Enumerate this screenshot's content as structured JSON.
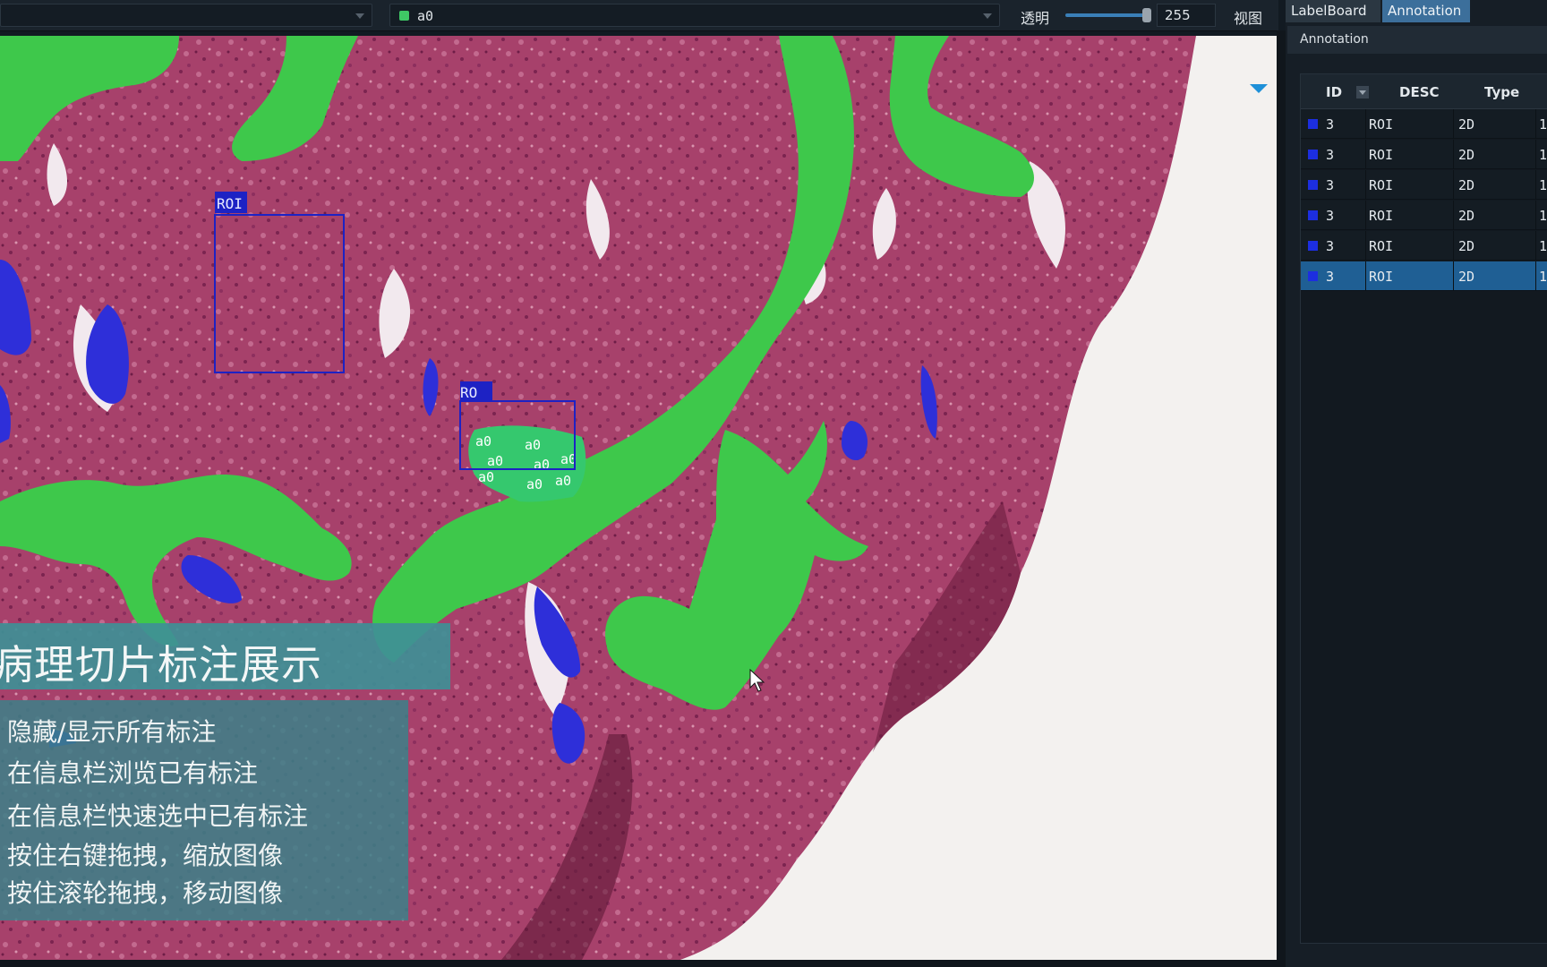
{
  "toolbar": {
    "label_select_value": "a0",
    "label_color": "#3fc865",
    "opacity_label": "透明",
    "opacity_value": "255",
    "opacity_level": 1.0,
    "view_label": "视图"
  },
  "viewer": {
    "roi_tag": "ROI",
    "roi_tag_partial": "RO",
    "annotation_text": "a0",
    "colors": {
      "tissue": "#a7416b",
      "background": "#f3f1ef",
      "green_annotation": "#3ec84b",
      "blue_annotation": "#2e2fd9",
      "roi_box": "#1d22c4"
    }
  },
  "overlay": {
    "title": "病理切片标注展示",
    "steps": [
      "隐藏/显示所有标注",
      "在信息栏浏览已有标注",
      "在信息栏快速选中已有标注",
      "按住右键拖拽，缩放图像",
      "按住滚轮拖拽，移动图像"
    ]
  },
  "right_panel": {
    "tabs": [
      "LabelBoard",
      "Annotation"
    ],
    "active_tab": "Annotation",
    "section_title": "Annotation",
    "columns": [
      "ID",
      "DESC",
      "Type"
    ],
    "rows": [
      {
        "id": "3",
        "desc": "ROI",
        "type": "2D",
        "extra": "1",
        "selected": false
      },
      {
        "id": "3",
        "desc": "ROI",
        "type": "2D",
        "extra": "1",
        "selected": false
      },
      {
        "id": "3",
        "desc": "ROI",
        "type": "2D",
        "extra": "1",
        "selected": false
      },
      {
        "id": "3",
        "desc": "ROI",
        "type": "2D",
        "extra": "1",
        "selected": false
      },
      {
        "id": "3",
        "desc": "ROI",
        "type": "2D",
        "extra": "1",
        "selected": false
      },
      {
        "id": "3",
        "desc": "ROI",
        "type": "2D",
        "extra": "1",
        "selected": true
      }
    ],
    "row_color": "#1c2ee0"
  }
}
